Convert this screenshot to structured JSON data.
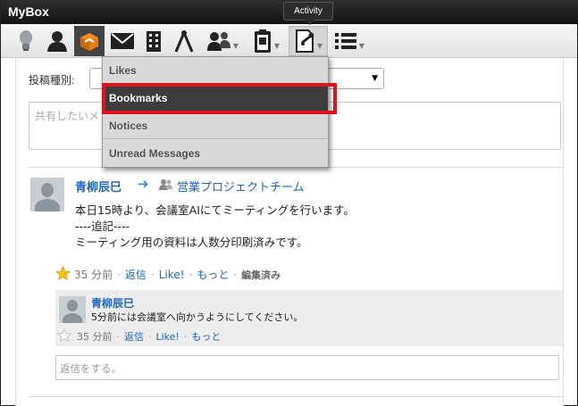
{
  "app": {
    "title": "MyBox"
  },
  "tooltip": {
    "text": "Activity"
  },
  "toolbar": {
    "icons": [
      {
        "name": "lightbulb-icon"
      },
      {
        "name": "person-icon"
      },
      {
        "name": "box-icon"
      },
      {
        "name": "mail-icon"
      },
      {
        "name": "building-icon"
      },
      {
        "name": "compass-icon"
      },
      {
        "name": "group-icon"
      },
      {
        "name": "clipboard-icon"
      },
      {
        "name": "activity-icon"
      },
      {
        "name": "list-icon"
      }
    ]
  },
  "compose": {
    "type_label": "投稿種別:",
    "placeholder": "共有したいメ"
  },
  "dropdown": {
    "items": [
      {
        "label": "Likes"
      },
      {
        "label": "Bookmarks"
      },
      {
        "label": "Notices"
      },
      {
        "label": "Unread Messages"
      }
    ]
  },
  "post": {
    "author": "青柳辰巳",
    "group": "営業プロジェクトチーム",
    "body_line1": "本日15時より、会議室AIにてミーティングを行います。",
    "body_line2": "----追記----",
    "body_line3": "ミーティング用の資料は人数分印刷済みです。",
    "time": "35 分前",
    "reply": "返信",
    "like": "Like!",
    "more": "もっと",
    "edited": "編集済み"
  },
  "reply": {
    "author": "青柳辰巳",
    "text": "5分前には会議室へ向かうようにしてください。",
    "time": "35 分前",
    "reply": "返信",
    "like": "Like!",
    "more": "もっと",
    "input_placeholder": "返信をする。"
  },
  "colors": {
    "link": "#2266bb",
    "highlight": "#e0121f",
    "selected_bg": "#3d3d3d"
  }
}
